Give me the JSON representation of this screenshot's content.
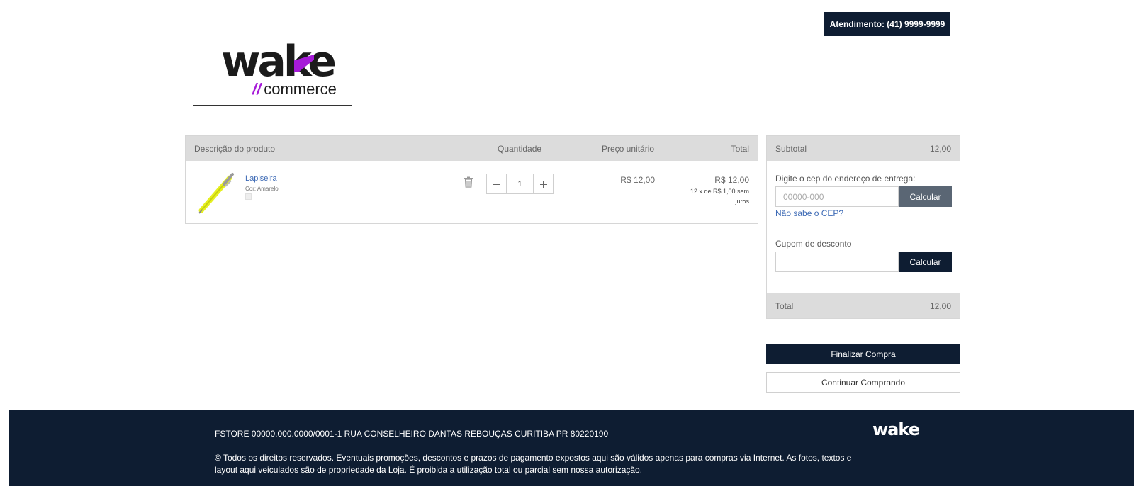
{
  "header": {
    "support_label": "Atendimento: (41) 9999-9999",
    "logo_word": "wake",
    "logo_sub": "commerce",
    "logo_slashes": "//"
  },
  "cart": {
    "columns": [
      "Descrição do produto",
      "Quantidade",
      "Preço unitário",
      "Total"
    ],
    "items": [
      {
        "name": "Lapiseira",
        "variant": "Cor: Amarelo",
        "quantity": "1",
        "unit_price": "R$ 12,00",
        "total": "R$ 12,00",
        "installments": "12 x de R$ 1,00 sem juros",
        "image_color": "#e6f020"
      }
    ]
  },
  "summary": {
    "subtotal_label": "Subtotal",
    "subtotal_value": "12,00",
    "cep_label": "Digite o cep do endereço de entrega:",
    "cep_placeholder": "00000-000",
    "cep_button": "Calcular",
    "cep_link": "Não sabe o CEP?",
    "coupon_label": "Cupom de desconto",
    "coupon_button": "Calcular",
    "total_label": "Total",
    "total_value": "12,00"
  },
  "actions": {
    "finish": "Finalizar Compra",
    "continue": "Continuar Comprando"
  },
  "footer": {
    "address": "FSTORE 00000.000.0000/0001-1 RUA CONSELHEIRO DANTAS REBOUÇAS CURITIBA PR 80220190",
    "copyright": "© Todos os direitos reservados. Eventuais promoções, descontos e prazos de pagamento expostos aqui são válidos apenas para compras via Internet. As fotos, textos e layout aqui veiculados são de propriedade da Loja. É proibida a utilização total ou parcial sem nossa autorização.",
    "logo": "wake"
  },
  "colors": {
    "navy": "#0e1d32",
    "accent_purple": "#a61ad8",
    "link_blue": "#3d6ab5",
    "header_gray": "#dcdcdc"
  }
}
